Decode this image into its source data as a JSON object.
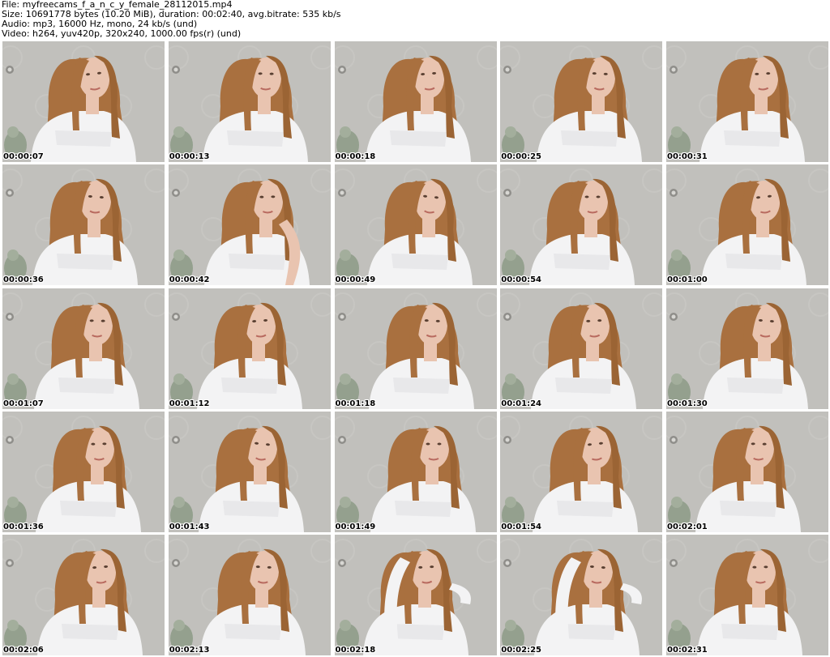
{
  "header": {
    "file": "File: myfreecams_f_a_n_c_y_female_28112015.mp4",
    "size": "Size: 10691778 bytes (10.20 MiB), duration: 00:02:40, avg.bitrate: 535 kb/s",
    "audio": "Audio: mp3, 16000 Hz, mono, 24 kb/s (und)",
    "video": "Video: h264, yuv420p, 320x240, 1000.00 fps(r) (und)"
  },
  "thumbnails": [
    {
      "timestamp": "00:00:07",
      "pose": "normal"
    },
    {
      "timestamp": "00:00:13",
      "pose": "normal"
    },
    {
      "timestamp": "00:00:18",
      "pose": "normal"
    },
    {
      "timestamp": "00:00:25",
      "pose": "normal"
    },
    {
      "timestamp": "00:00:31",
      "pose": "normal"
    },
    {
      "timestamp": "00:00:36",
      "pose": "normal"
    },
    {
      "timestamp": "00:00:42",
      "pose": "hand"
    },
    {
      "timestamp": "00:00:49",
      "pose": "normal"
    },
    {
      "timestamp": "00:00:54",
      "pose": "normal"
    },
    {
      "timestamp": "00:01:00",
      "pose": "normal"
    },
    {
      "timestamp": "00:01:07",
      "pose": "normal"
    },
    {
      "timestamp": "00:01:12",
      "pose": "normal"
    },
    {
      "timestamp": "00:01:18",
      "pose": "normal"
    },
    {
      "timestamp": "00:01:24",
      "pose": "normal"
    },
    {
      "timestamp": "00:01:30",
      "pose": "normal"
    },
    {
      "timestamp": "00:01:36",
      "pose": "normal"
    },
    {
      "timestamp": "00:01:43",
      "pose": "normal"
    },
    {
      "timestamp": "00:01:49",
      "pose": "normal"
    },
    {
      "timestamp": "00:01:54",
      "pose": "normal"
    },
    {
      "timestamp": "00:02:01",
      "pose": "normal"
    },
    {
      "timestamp": "00:02:06",
      "pose": "normal"
    },
    {
      "timestamp": "00:02:13",
      "pose": "normal"
    },
    {
      "timestamp": "00:02:18",
      "pose": "arm-up"
    },
    {
      "timestamp": "00:02:25",
      "pose": "arm-up"
    },
    {
      "timestamp": "00:02:31",
      "pose": "normal"
    }
  ],
  "colors": {
    "wall": "#b9b8b4",
    "hair": "#a9703f",
    "skin": "#e9c4b0",
    "shirt": "#f3f3f4"
  }
}
